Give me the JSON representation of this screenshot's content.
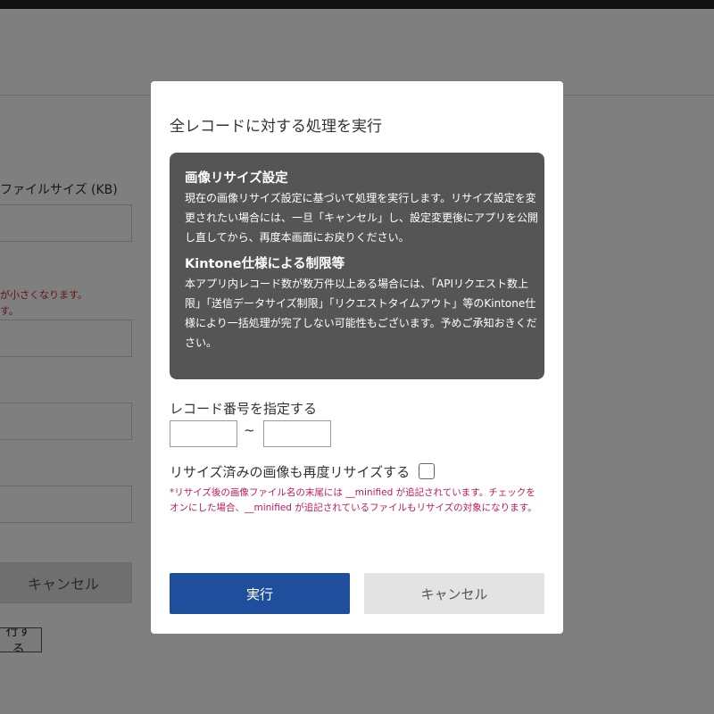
{
  "background": {
    "field_label": "ファイルサイズ (KB)",
    "note_line1": "が小さくなります。",
    "note_line2": "す。",
    "cancel_label": "キャンセル",
    "run_label": "行する"
  },
  "modal": {
    "title": "全レコードに対する処理を実行",
    "info": {
      "heading1": "画像リサイズ設定",
      "text1": "現在の画像リサイズ設定に基づいて処理を実行します。リサイズ設定を変更されたい場合には、一旦「キャンセル」し、設定変更後にアプリを公開し直してから、再度本画面にお戻りください。",
      "heading2": "Kintone仕様による制限等",
      "text2": "本アプリ内レコード数が数万件以上ある場合には、「APIリクエスト数上限」「送信データサイズ制限」「リクエストタイムアウト」等のKintone仕様により一括処理が完了しない可能性もございます。予めご承知おきください。"
    },
    "range": {
      "label": "レコード番号を指定する",
      "from_value": "",
      "to_value": "",
      "separator": "~"
    },
    "resize": {
      "label": "リサイズ済みの画像も再度リサイズする",
      "checked": false,
      "note": "*リサイズ後の画像ファイル名の末尾には __minified が追記されています。チェックをオンにした場合、__minified が追記されているファイルもリサイズの対象になります。"
    },
    "buttons": {
      "run_label": "実行",
      "cancel_label": "キャンセル"
    }
  },
  "colors": {
    "primary_button": "#1f4e9c",
    "info_box_bg": "#555555",
    "note_text": "#c2185b",
    "overlay": "rgba(0,0,0,0.5)"
  }
}
